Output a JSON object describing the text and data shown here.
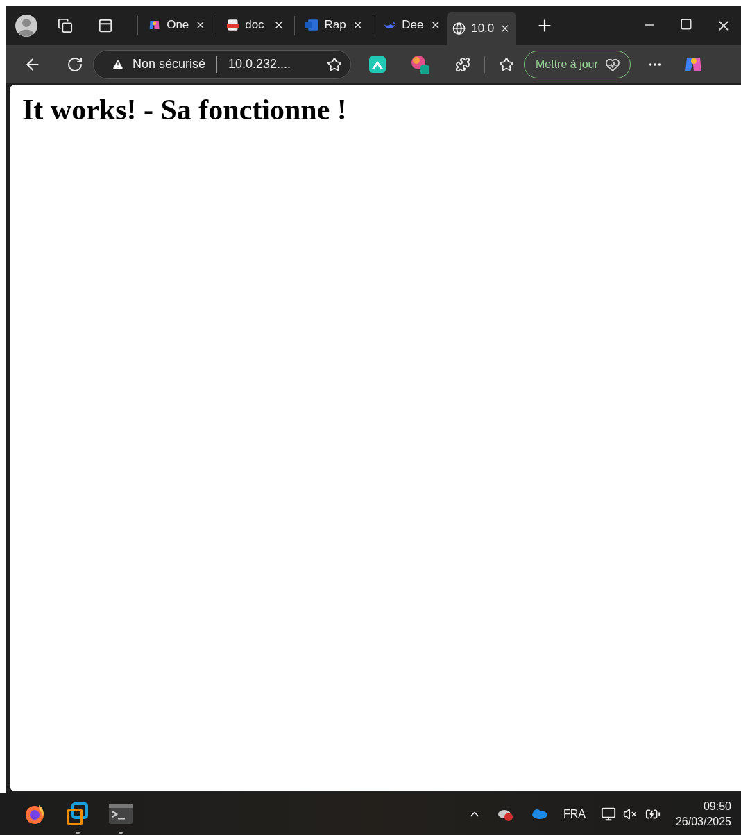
{
  "tabs": [
    {
      "kind": "copilot",
      "title": "One",
      "selected": false
    },
    {
      "kind": "pdf",
      "title": "doc",
      "selected": false
    },
    {
      "kind": "word",
      "title": "Rap",
      "selected": false
    },
    {
      "kind": "whale",
      "title": "Dee",
      "selected": false
    },
    {
      "kind": "globe",
      "title": "10.0",
      "selected": true
    }
  ],
  "address_bar": {
    "security": "Non sécurisé",
    "url": "10.0.232...."
  },
  "update_button": "Mettre à jour",
  "page": {
    "heading": "It works! - Sa fonctionne !"
  },
  "taskbar": {
    "apps": [
      {
        "kind": "firefox",
        "running": false
      },
      {
        "kind": "vmware",
        "running": true
      },
      {
        "kind": "terminal",
        "running": true
      }
    ],
    "language": "FRA",
    "time": "09:50",
    "date": "26/03/2025"
  }
}
